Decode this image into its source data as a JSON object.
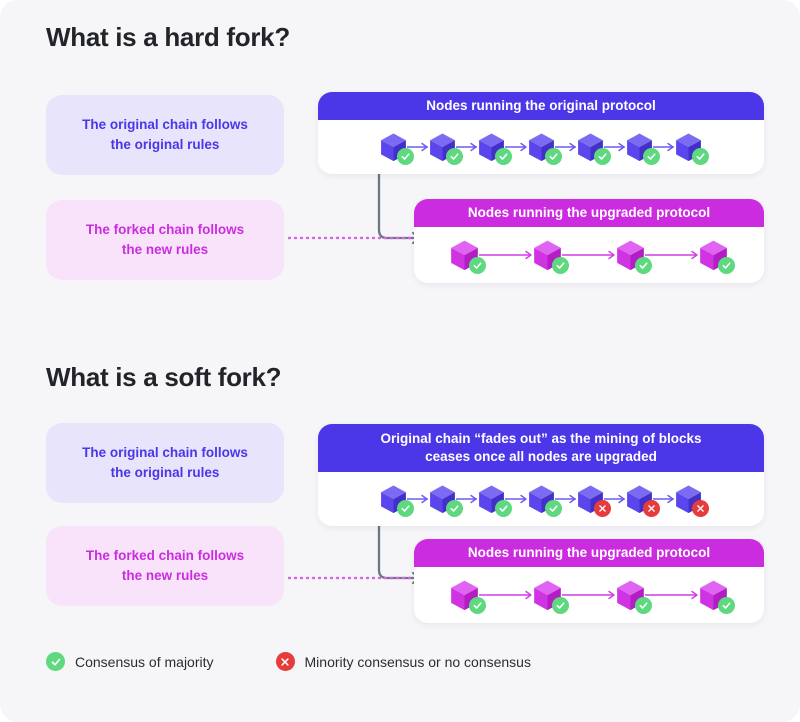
{
  "page": {
    "background": "#f6f6f8",
    "colors": {
      "blue": "#4b36e8",
      "magenta": "#cc2ce0",
      "blue_soft_bg": "#e7e4fb",
      "magenta_soft_bg": "#f8e3fb",
      "green": "#5fd97f",
      "red": "#e63c3c",
      "heading": "#22242a"
    }
  },
  "sections": [
    {
      "id": "hard-fork",
      "title": "What is a hard fork?",
      "labels": {
        "original": "The original chain follows\nthe original rules",
        "forked": "The forked chain follows\nthe new rules"
      },
      "chains": [
        {
          "id": "original-protocol",
          "header": "Nodes running the original protocol",
          "theme": "blue",
          "node_count": 7,
          "node_status": [
            "ok",
            "ok",
            "ok",
            "ok",
            "ok",
            "ok",
            "ok"
          ]
        },
        {
          "id": "upgraded-protocol",
          "header": "Nodes running the upgraded protocol",
          "theme": "magenta",
          "node_count": 4,
          "node_status": [
            "ok",
            "ok",
            "ok",
            "ok"
          ]
        }
      ]
    },
    {
      "id": "soft-fork",
      "title": "What is a soft fork?",
      "labels": {
        "original": "The original chain follows\nthe original rules",
        "forked": "The forked chain follows\nthe new rules"
      },
      "chains": [
        {
          "id": "fading-original-chain",
          "header": "Original chain “fades out” as the mining of blocks\nceases once all nodes are upgraded",
          "theme": "blue",
          "node_count": 7,
          "node_status": [
            "ok",
            "ok",
            "ok",
            "ok",
            "fail",
            "fail",
            "fail"
          ]
        },
        {
          "id": "upgraded-protocol",
          "header": "Nodes running the upgraded protocol",
          "theme": "magenta",
          "node_count": 4,
          "node_status": [
            "ok",
            "ok",
            "ok",
            "ok"
          ]
        }
      ]
    }
  ],
  "legend": {
    "items": [
      {
        "icon": "check-circle-icon",
        "status": "ok",
        "label": "Consensus of majority"
      },
      {
        "icon": "x-circle-icon",
        "status": "fail",
        "label": "Minority consensus or no consensus"
      }
    ]
  }
}
